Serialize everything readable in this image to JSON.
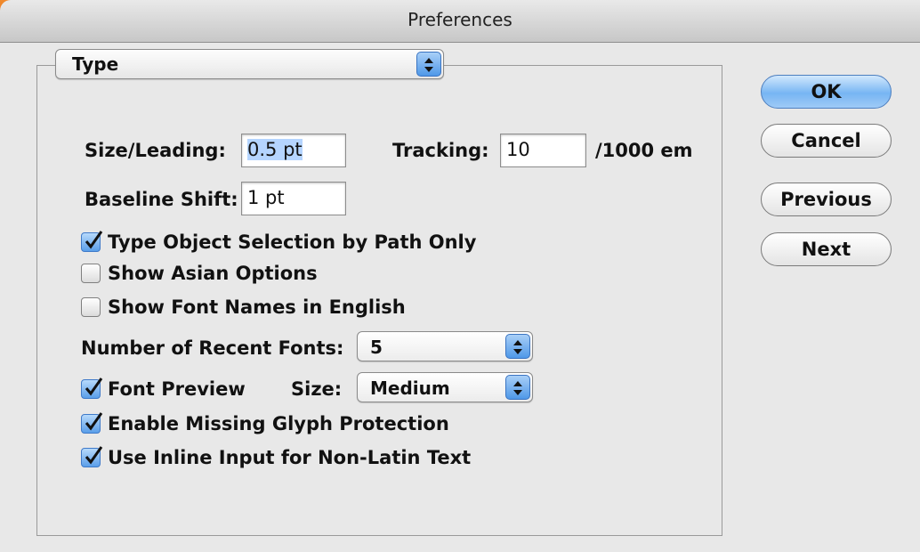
{
  "window": {
    "title": "Preferences"
  },
  "panel_popup": {
    "value": "Type"
  },
  "size_leading": {
    "label": "Size/Leading:",
    "value": "0.5 pt"
  },
  "tracking": {
    "label": "Tracking:",
    "value": "10",
    "unit": "/1000 em"
  },
  "baseline_shift": {
    "label": "Baseline Shift:",
    "value": "1 pt"
  },
  "checkboxes": {
    "type_object_selection": {
      "label": "Type Object Selection by Path Only",
      "checked": true
    },
    "show_asian_options": {
      "label": "Show Asian Options",
      "checked": false
    },
    "show_font_names_english": {
      "label": "Show Font Names in English",
      "checked": false
    },
    "font_preview": {
      "label": "Font Preview",
      "checked": true
    },
    "missing_glyph": {
      "label": "Enable Missing Glyph Protection",
      "checked": true
    },
    "inline_input": {
      "label": "Use Inline Input for Non-Latin Text",
      "checked": true
    }
  },
  "recent_fonts": {
    "label": "Number of Recent Fonts:",
    "value": "5"
  },
  "preview_size": {
    "label": "Size:",
    "value": "Medium"
  },
  "buttons": {
    "ok": "OK",
    "cancel": "Cancel",
    "previous": "Previous",
    "next": "Next"
  },
  "colors": {
    "accent_blue": "#77b5f3",
    "selection": "#b5d5ff",
    "orange_corner": "#e0661a"
  }
}
